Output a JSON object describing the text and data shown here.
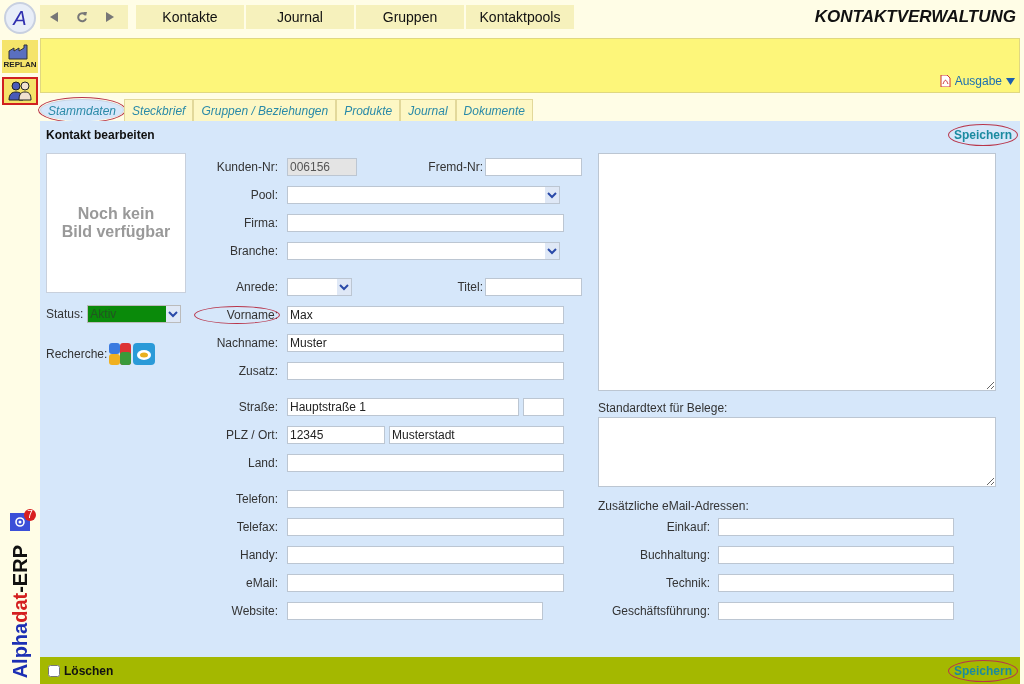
{
  "app_logo": "A",
  "nav": {
    "items": [
      {
        "label": "Kontakte"
      },
      {
        "label": "Journal"
      },
      {
        "label": "Gruppen"
      },
      {
        "label": "Kontaktpools"
      }
    ]
  },
  "page_title": "KONTAKTVERWALTUNG",
  "sidebar": {
    "items": [
      {
        "kind": "factory",
        "label": "REPLAN",
        "selected": false
      },
      {
        "kind": "people",
        "selected": true
      }
    ],
    "mail_badge": "7",
    "brand": [
      {
        "text": "Alpha",
        "color": "#1c2fb4"
      },
      {
        "text": "dat",
        "color": "#d42020"
      },
      {
        "text": "-ERP",
        "color": "#111111"
      }
    ]
  },
  "toolbar": {
    "output_label": "Ausgabe"
  },
  "tabs": [
    {
      "label": "Stammdaten",
      "selected": true,
      "circled": true
    },
    {
      "label": "Steckbrief",
      "selected": false,
      "circled": false
    },
    {
      "label": "Gruppen / Beziehungen",
      "selected": false,
      "circled": false
    },
    {
      "label": "Produkte",
      "selected": false,
      "circled": false
    },
    {
      "label": "Journal",
      "selected": false,
      "circled": false
    },
    {
      "label": "Dokumente",
      "selected": false,
      "circled": false
    }
  ],
  "form": {
    "title": "Kontakt bearbeiten",
    "save_top": {
      "label": "Speichern",
      "circled": true
    },
    "photo_text": "Noch kein Bild verfügbar",
    "status": {
      "label": "Status:",
      "value": "Aktiv",
      "color": "#0a8a0a"
    },
    "research_label": "Recherche:",
    "field_groups": [
      [
        {
          "label": "Kunden-Nr:",
          "kind": "readonly",
          "value": "006156",
          "circled": false,
          "side": {
            "label": "Fremd-Nr:"
          }
        },
        {
          "label": "Pool:",
          "kind": "select",
          "circled": false
        },
        {
          "label": "Firma:",
          "kind": "text",
          "circled": false
        },
        {
          "label": "Branche:",
          "kind": "select",
          "circled": false
        }
      ],
      [
        {
          "label": "Anrede:",
          "kind": "short-select",
          "circled": false,
          "side": {
            "label": "Titel:"
          }
        },
        {
          "label": "Vorname:",
          "kind": "text",
          "value": "Max",
          "circled": true
        },
        {
          "label": "Nachname:",
          "kind": "text",
          "value": "Muster",
          "circled": false
        },
        {
          "label": "Zusatz:",
          "kind": "text",
          "circled": false
        }
      ],
      [
        {
          "label": "Straße:",
          "kind": "street",
          "value": "Hauptstraße 1",
          "circled": false
        },
        {
          "label": "PLZ / Ort:",
          "kind": "zip-city",
          "value": "12345",
          "value2": "Musterstadt",
          "circled": false
        },
        {
          "label": "Land:",
          "kind": "text",
          "circled": false
        }
      ],
      [
        {
          "label": "Telefon:",
          "kind": "text",
          "circled": false
        },
        {
          "label": "Telefax:",
          "kind": "text",
          "circled": false
        },
        {
          "label": "Handy:",
          "kind": "text",
          "circled": false
        },
        {
          "label": "eMail:",
          "kind": "text",
          "circled": false
        },
        {
          "label": "Website:",
          "kind": "text-short",
          "circled": false
        }
      ]
    ],
    "notes_label": "Standardtext für Belege:",
    "extra_emails_label": "Zusätzliche eMail-Adressen:",
    "extra_emails": [
      {
        "label": "Einkauf:"
      },
      {
        "label": "Buchhaltung:"
      },
      {
        "label": "Technik:"
      },
      {
        "label": "Geschäftsführung:"
      }
    ]
  },
  "footer": {
    "delete": {
      "label": "Löschen",
      "checked": false
    },
    "save": {
      "label": "Speichern",
      "circled": true
    }
  }
}
